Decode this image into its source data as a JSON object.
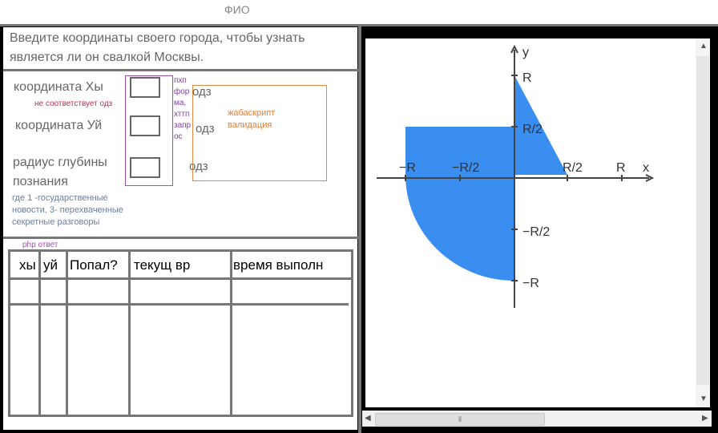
{
  "header": {
    "title": "ФИО"
  },
  "form": {
    "prompt_line1": "Введите координаты своего города, чтобы узнать",
    "prompt_line2": "является ли он свалкой Москвы.",
    "x_label": "координата Хы",
    "y_label": "координата Уй",
    "r_label_line1": "радиус глубины",
    "r_label_line2": "познания",
    "error_text": "не соответствует одз",
    "php_note": "пхп форма, хттп запрос",
    "odz": "одз",
    "js_note_line1": "жабаскрипт",
    "js_note_line2": "валидация",
    "depth_note_line1": "где 1 -государственные",
    "depth_note_line2": "новости, 3- перехваченные",
    "depth_note_line3": "секретные разговоры"
  },
  "results": {
    "php_answer_label": "php ответ",
    "columns": [
      "хы",
      "уй",
      "Попал?",
      "текущ вр",
      "время выполн"
    ]
  },
  "graph": {
    "y_axis": "y",
    "x_axis": "x",
    "labels": {
      "R": "R",
      "R_half": "R/2",
      "neg_R": "−R",
      "neg_R_half": "−R/2"
    },
    "fill_color": "#3a8ef0"
  },
  "scrollbars": {
    "h_thumb_glyph": "⦀",
    "left_arrow": "◀",
    "right_arrow": "▶",
    "up_arrow": "▲",
    "down_arrow": "▼"
  }
}
